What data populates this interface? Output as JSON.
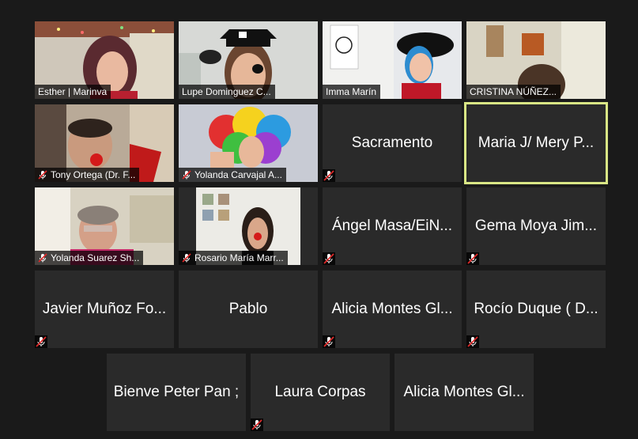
{
  "meeting": {
    "participants": [
      {
        "name": "Esther | Marinva",
        "muted": false,
        "video": true
      },
      {
        "name": "Lupe Dominguez C...",
        "muted": false,
        "video": true
      },
      {
        "name": "Imma Marín",
        "muted": false,
        "video": true
      },
      {
        "name": "CRISTINA NÚÑEZ...",
        "muted": false,
        "video": true
      },
      {
        "name": "Tony Ortega (Dr. F...",
        "muted": true,
        "video": true
      },
      {
        "name": "Yolanda Carvajal A...",
        "muted": true,
        "video": true
      },
      {
        "name": "Sacramento",
        "muted": true,
        "video": false
      },
      {
        "name": "Maria J/ Mery P...",
        "muted": false,
        "video": false,
        "active_speaker": true
      },
      {
        "name": "Yolanda Suarez Sh...",
        "muted": true,
        "video": true
      },
      {
        "name": "Rosario María Marr...",
        "muted": true,
        "video": true
      },
      {
        "name": "Ángel Masa/EiN...",
        "muted": true,
        "video": false
      },
      {
        "name": "Gema Moya Jim...",
        "muted": true,
        "video": false
      },
      {
        "name": "Javier Muñoz Fo...",
        "muted": true,
        "video": false
      },
      {
        "name": "Pablo",
        "muted": false,
        "video": false
      },
      {
        "name": "Alicia Montes Gl...",
        "muted": true,
        "video": false
      },
      {
        "name": "Rocío Duque ( D...",
        "muted": true,
        "video": false
      },
      {
        "name": "Bienve Peter Pan ;",
        "muted": false,
        "video": false
      },
      {
        "name": "Laura Corpas",
        "muted": true,
        "video": false
      },
      {
        "name": "Alicia Montes Gl...",
        "muted": false,
        "video": false
      }
    ]
  },
  "colors": {
    "background": "#1a1a1a",
    "tile": "#2a2a2a",
    "active_speaker_border": "#d9e685",
    "mute_icon": "#e02828"
  },
  "icons": {
    "muted_microphone": "muted-microphone-icon"
  }
}
